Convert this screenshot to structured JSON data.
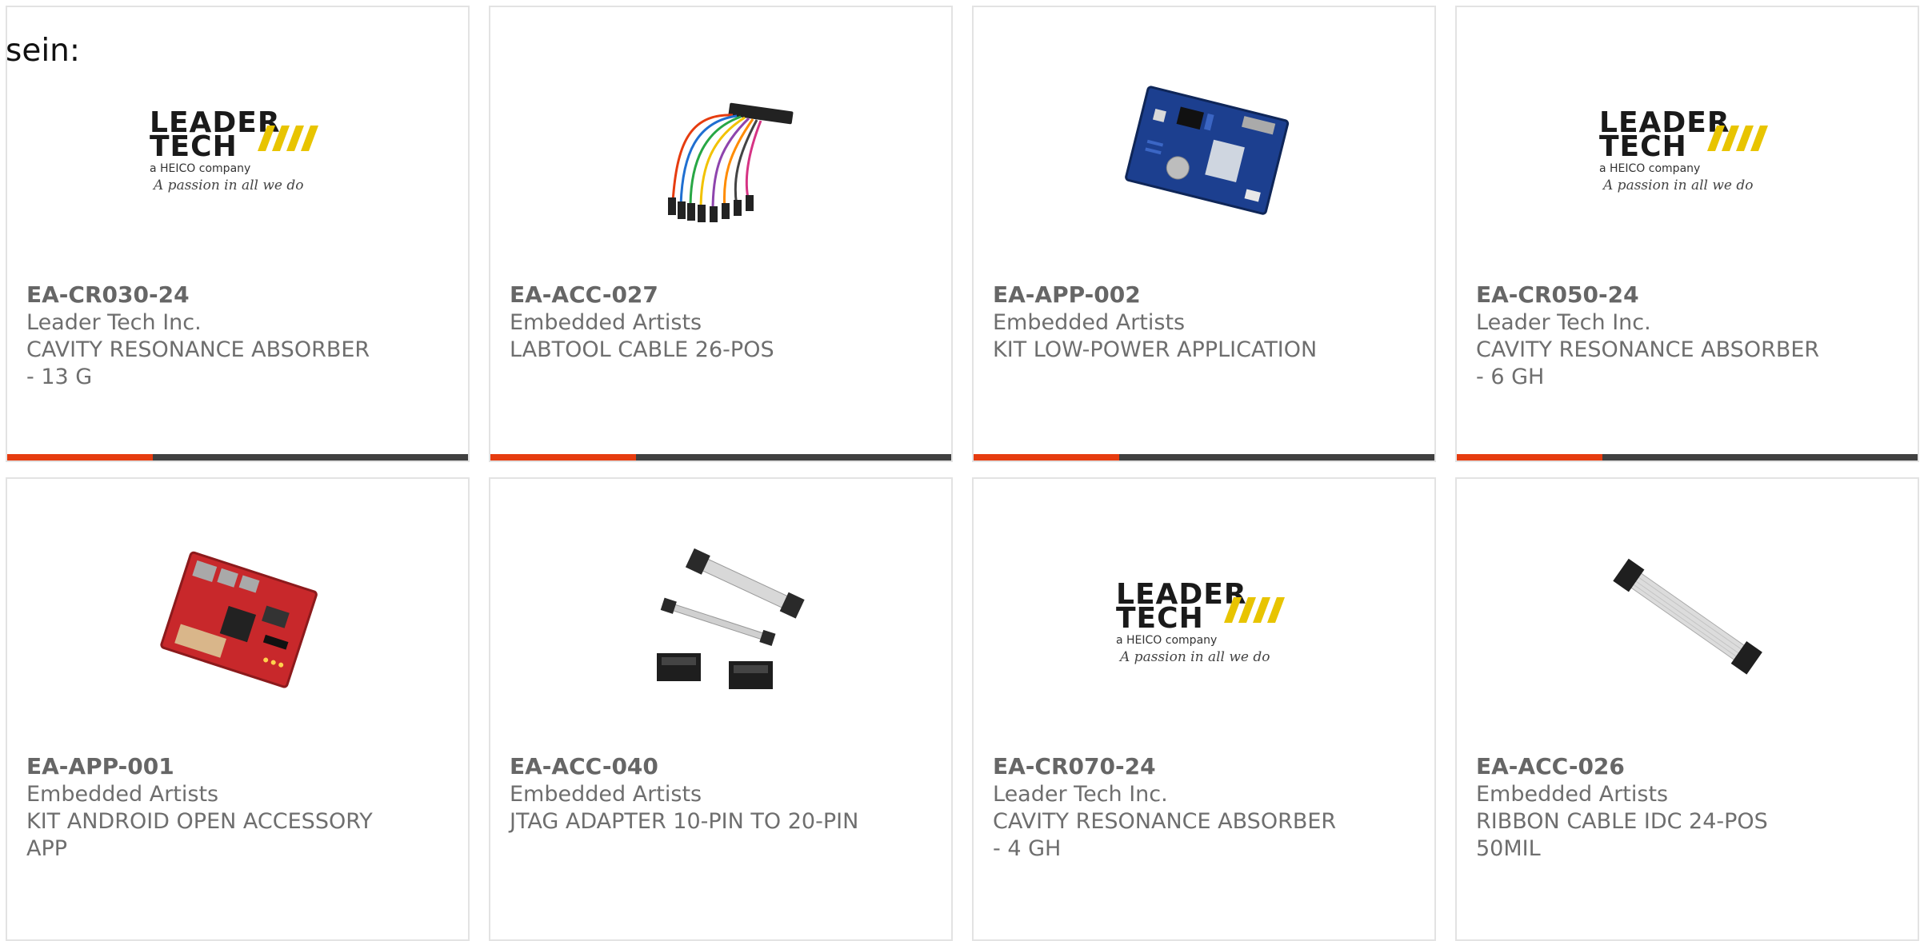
{
  "intro_text": "sein:",
  "colors": {
    "accent": "#e63c0f",
    "bar": "#404040",
    "border": "#e3e3e3",
    "text": "#6e6e6e"
  },
  "logo": {
    "line1": "LEADER",
    "line2": "TECH",
    "company": "a HEICO company",
    "tagline": "A passion in all we do"
  },
  "products": [
    {
      "part": "EA-CR030-24",
      "manufacturer": "Leader Tech Inc.",
      "description": "CAVITY RESONANCE ABSORBER - 13 G",
      "image": "leader-tech-logo"
    },
    {
      "part": "EA-ACC-027",
      "manufacturer": "Embedded Artists",
      "description": "LABTOOL CABLE 26-POS",
      "image": "jumper-cable-photo"
    },
    {
      "part": "EA-APP-002",
      "manufacturer": "Embedded Artists",
      "description": "KIT LOW-POWER APPLICATION",
      "image": "blue-board-photo"
    },
    {
      "part": "EA-CR050-24",
      "manufacturer": "Leader Tech Inc.",
      "description": "CAVITY RESONANCE ABSORBER - 6 GH",
      "image": "leader-tech-logo"
    },
    {
      "part": "EA-APP-001",
      "manufacturer": "Embedded Artists",
      "description": "KIT ANDROID OPEN ACCESSORY APP",
      "image": "red-board-photo"
    },
    {
      "part": "EA-ACC-040",
      "manufacturer": "Embedded Artists",
      "description": "JTAG ADAPTER 10-PIN TO 20-PIN",
      "image": "jtag-adapter-photo"
    },
    {
      "part": "EA-CR070-24",
      "manufacturer": "Leader Tech Inc.",
      "description": "CAVITY RESONANCE ABSORBER - 4 GH",
      "image": "leader-tech-logo"
    },
    {
      "part": "EA-ACC-026",
      "manufacturer": "Embedded Artists",
      "description": "RIBBON CABLE IDC 24-POS 50MIL",
      "image": "ribbon-cable-photo"
    }
  ]
}
